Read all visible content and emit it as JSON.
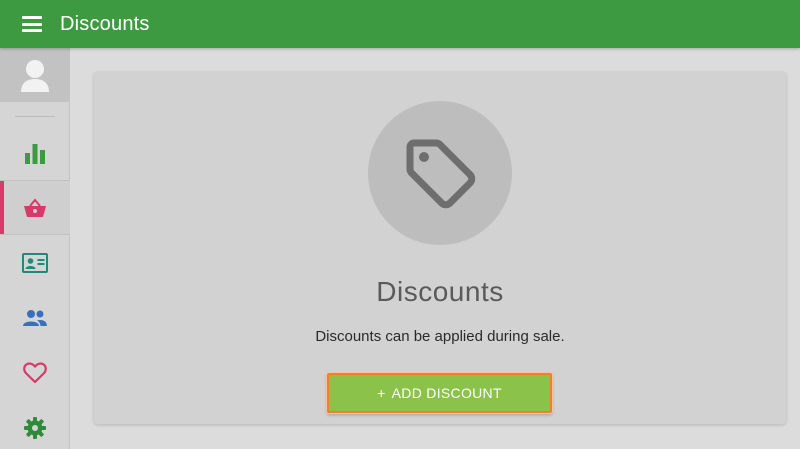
{
  "header": {
    "title": "Discounts",
    "menu_icon": "hamburger-menu-icon",
    "bar_color": "#3e9a40"
  },
  "sidebar": {
    "avatar_icon": "user-avatar-icon",
    "items": [
      {
        "name": "reports",
        "icon": "bar-chart-icon",
        "color": "#3e9a40",
        "active": false
      },
      {
        "name": "sales",
        "icon": "basket-icon",
        "color": "#d63a6b",
        "active": true
      },
      {
        "name": "customers",
        "icon": "id-card-icon",
        "color": "#1e8a7a",
        "active": false
      },
      {
        "name": "users",
        "icon": "people-icon",
        "color": "#3a6fc0",
        "active": false
      },
      {
        "name": "favorites",
        "icon": "heart-icon",
        "color": "#d63a6b",
        "active": false
      },
      {
        "name": "settings",
        "icon": "gear-icon",
        "color": "#2e8b3a",
        "active": false
      }
    ]
  },
  "main": {
    "icon": "tag-icon",
    "title": "Discounts",
    "description": "Discounts can be applied during sale.",
    "add_button": {
      "plus": "+",
      "label": "ADD DISCOUNT",
      "color": "#8bc34a",
      "highlight_color": "#f08030"
    }
  }
}
